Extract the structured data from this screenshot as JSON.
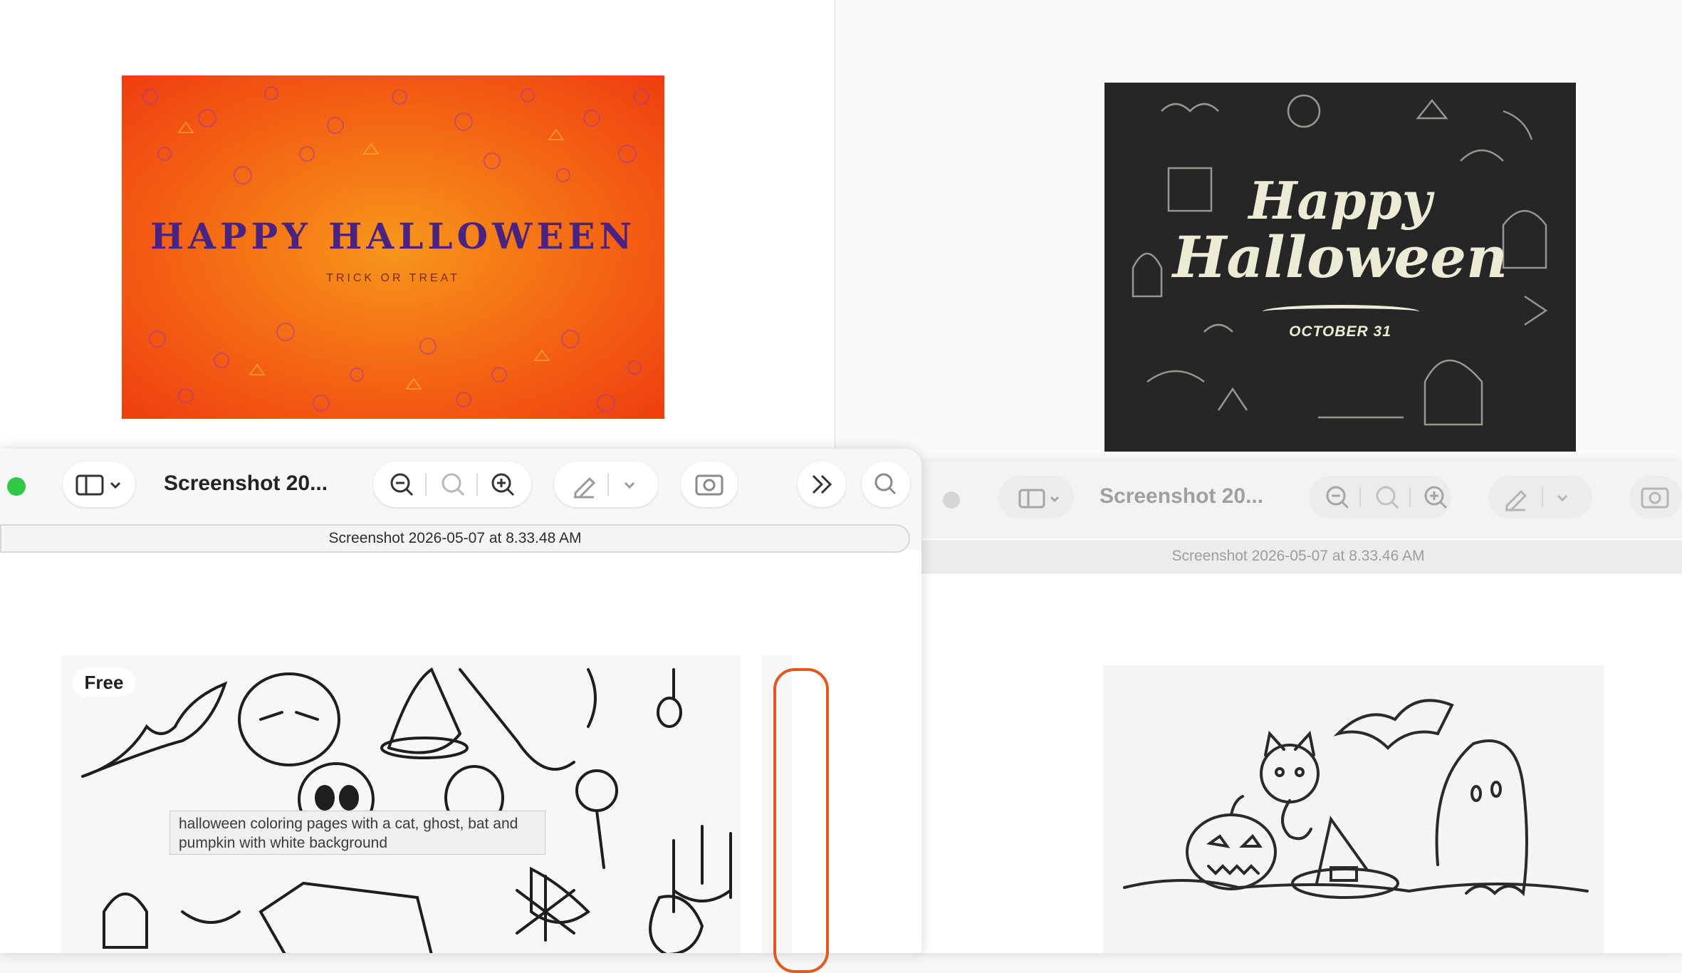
{
  "back_left": {
    "card_title": "HAPPY HALLOWEEN",
    "card_subtitle": "TRICK OR TREAT"
  },
  "back_right": {
    "card_line1": "Happy",
    "card_line2": "Halloween",
    "card_date": "OCTOBER 31"
  },
  "front_window": {
    "title": "Screenshot 20...",
    "document_name": "Screenshot 2026-05-07 at 8.33.48 AM",
    "badge": "Free",
    "tooltip": "halloween coloring pages with a cat, ghost, bat and pumpkin with white background"
  },
  "right_window": {
    "title": "Screenshot 20...",
    "document_name": "Screenshot 2026-05-07 at 8.33.46 AM"
  },
  "colors": {
    "traffic_green": "#33c748",
    "orange_accent": "#f46413",
    "purple_text": "#4a2280"
  },
  "icons": [
    "sidebar-icon",
    "chevron-down-icon",
    "zoom-out-icon",
    "actual-size-icon",
    "zoom-in-icon",
    "markup-pen-icon",
    "image-adjust-icon",
    "more-chevrons-icon",
    "search-icon"
  ]
}
